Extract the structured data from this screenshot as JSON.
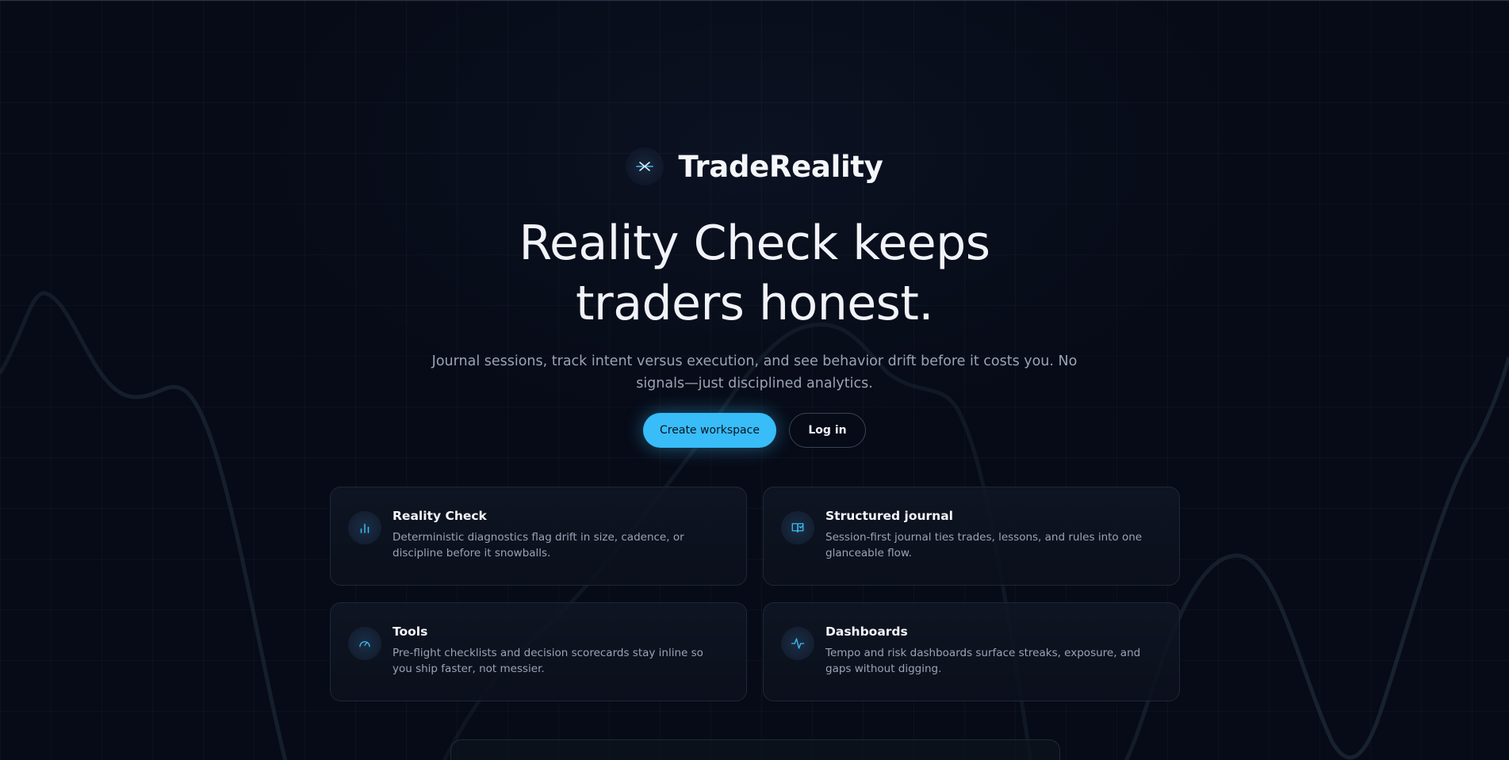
{
  "brand": {
    "name": "TradeReality",
    "icon": "trend-cross-icon"
  },
  "hero": {
    "headline_line1": "Reality Check keeps",
    "headline_line2": "traders honest.",
    "subtitle": "Journal sessions, track intent versus execution, and see behavior drift before it costs you. No signals—just disciplined analytics."
  },
  "cta": {
    "primary_label": "Create workspace",
    "secondary_label": "Log in"
  },
  "features": [
    {
      "title": "Reality Check",
      "description": "Deterministic diagnostics flag drift in size, cadence, or discipline before it snowballs.",
      "icon": "bar-chart-icon"
    },
    {
      "title": "Structured journal",
      "description": "Session-first journal ties trades, lessons, and rules into one glanceable flow.",
      "icon": "book-icon"
    },
    {
      "title": "Tools",
      "description": "Pre-flight checklists and decision scorecards stay inline so you ship faster, not messier.",
      "icon": "gauge-icon"
    },
    {
      "title": "Dashboards",
      "description": "Tempo and risk dashboards surface streaks, exposure, and gaps without digging.",
      "icon": "activity-icon"
    }
  ],
  "colors": {
    "background": "#070b17",
    "accent": "#38bdf8",
    "card_border": "#1f2736",
    "muted_text": "#9aa3b4"
  }
}
